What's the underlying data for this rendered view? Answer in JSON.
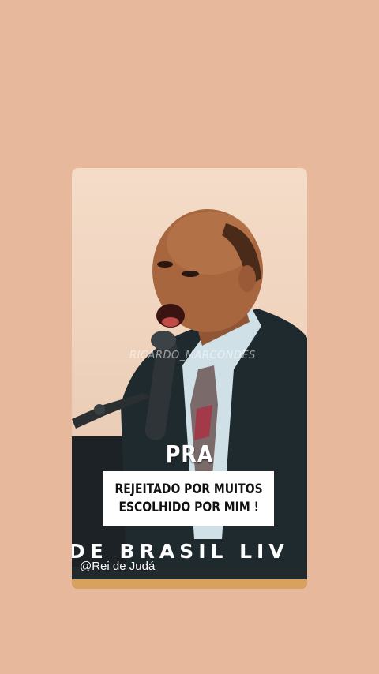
{
  "video": {
    "watermark": "RICARDO_MARCONDES",
    "speaker_label": "PRA",
    "caption_lines": [
      "REJEITADO POR MUITOS",
      "ESCOLHIDO POR MIM !"
    ],
    "banner": "DE BRASIL LIV",
    "handle": "@Rei de Judá"
  },
  "colors": {
    "background": "#e8b89c",
    "suit": "#1f2a2f",
    "shirt": "#cfe0e6",
    "skin": "#a8663f"
  }
}
